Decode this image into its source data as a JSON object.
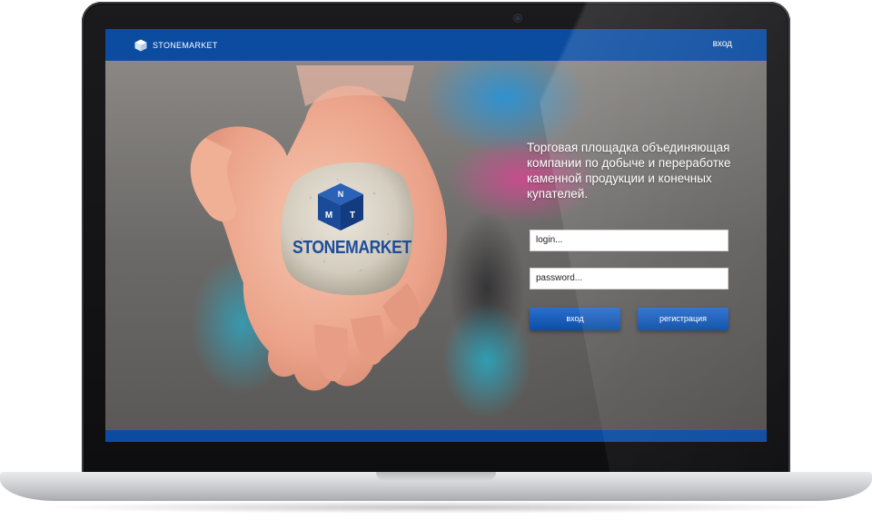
{
  "app": {
    "brand_name": "STONEMARKET",
    "login_link": "вход"
  },
  "hero": {
    "stone_brand": "STONEMARKET",
    "stone_logo_letters": [
      "N",
      "M",
      "T"
    ],
    "tagline": "Торговая площадка объединяющая компании по добыче и переработке каменной продукции и конечных купателей."
  },
  "form": {
    "login_value": "login...",
    "password_value": "password...",
    "login_button": "вход",
    "register_button": "регистрация"
  },
  "colors": {
    "brand_blue": "#0b4ca1",
    "button_blue": "#1a5fbf",
    "stone_text": "#1e4d9a"
  },
  "icons": {
    "brand_logo": "cube-logo-icon",
    "stone_logo": "cube-logo-icon"
  }
}
